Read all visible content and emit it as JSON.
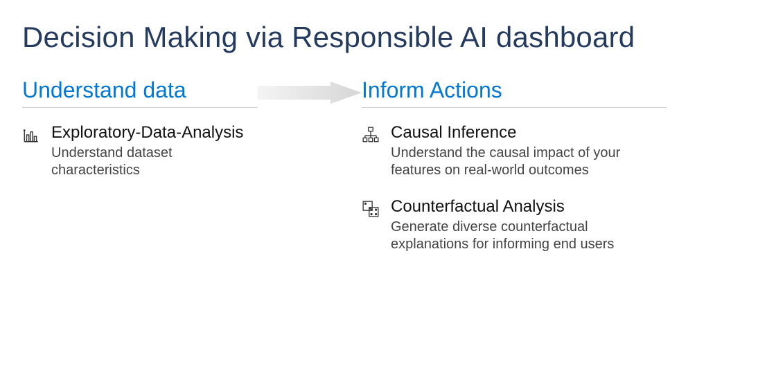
{
  "title": "Decision Making via Responsible AI dashboard",
  "left": {
    "heading": "Understand data",
    "items": [
      {
        "icon": "bar-chart-icon",
        "title": "Exploratory-Data-Analysis",
        "subtitle": "Understand dataset characteristics"
      }
    ]
  },
  "right": {
    "heading": "Inform Actions",
    "items": [
      {
        "icon": "hierarchy-icon",
        "title": "Causal Inference",
        "subtitle": "Understand the causal impact of your features on real-world outcomes"
      },
      {
        "icon": "dice-icon",
        "title": "Counterfactual Analysis",
        "subtitle": "Generate diverse counterfactual explanations for informing end users"
      }
    ]
  }
}
